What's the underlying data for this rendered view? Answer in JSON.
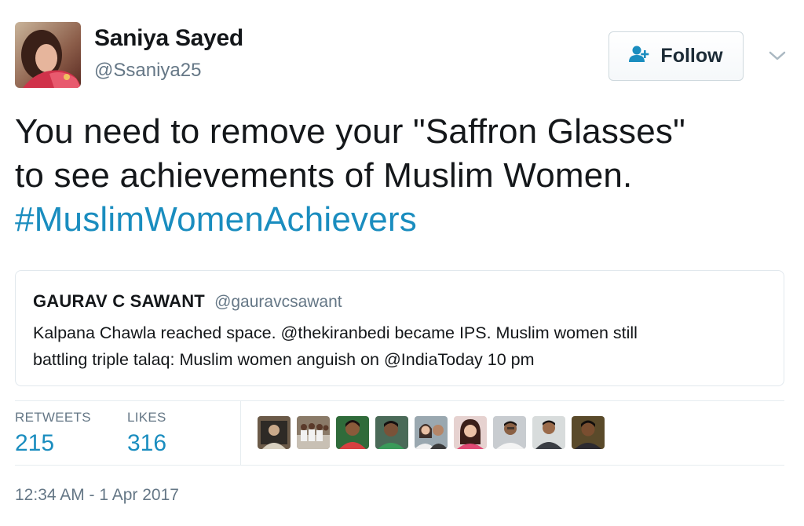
{
  "author": {
    "name": "Saniya Sayed",
    "handle": "@Ssaniya25"
  },
  "follow_button": {
    "label": "Follow",
    "icon": "add-user-icon"
  },
  "tweet": {
    "lines": [
      "You need to remove your \"Saffron Glasses\"",
      "to see achievements of Muslim Women."
    ],
    "hashtag": "#MuslimWomenAchievers"
  },
  "quoted_tweet": {
    "name": "GAURAV C SAWANT",
    "handle": "@gauravcsawant",
    "lines": [
      "Kalpana Chawla reached space. @thekiranbedi became IPS. Muslim women still",
      "battling triple talaq: Muslim women anguish on @IndiaToday 10 pm"
    ]
  },
  "stats": {
    "retweets_label": "RETWEETS",
    "retweets_value": "215",
    "likes_label": "LIKES",
    "likes_value": "316"
  },
  "liker_avatars": [
    "user-avatar-icon",
    "user-avatar-icon",
    "user-avatar-icon",
    "user-avatar-icon",
    "user-avatar-icon",
    "user-avatar-icon",
    "user-avatar-icon",
    "user-avatar-icon",
    "user-avatar-icon"
  ],
  "timestamp": "12:34 AM - 1 Apr 2017",
  "colors": {
    "link": "#1a8dbf",
    "secondary_text": "#657786",
    "border": "#e1e8ed"
  }
}
